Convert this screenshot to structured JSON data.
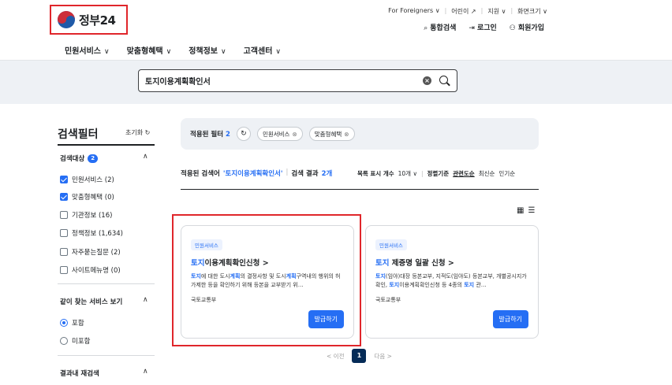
{
  "header": {
    "logo_text": "정부24",
    "util_links": [
      "For Foreigners ∨",
      "어린이 ↗",
      "지원 ∨",
      "화면크기 ∨"
    ],
    "actions": [
      {
        "icon": "search-icon",
        "label": "통합검색"
      },
      {
        "icon": "login-icon",
        "label": "로그인"
      },
      {
        "icon": "user-add-icon",
        "label": "회원가입"
      }
    ],
    "nav": [
      "민원서비스",
      "맞춤형혜택",
      "정책정보",
      "고객센터"
    ]
  },
  "search": {
    "value": "토지이용계획확인서"
  },
  "sidebar": {
    "title": "검색필터",
    "reset_label": "초기화",
    "target": {
      "title": "검색대상",
      "badge": "2",
      "items": [
        {
          "label": "민원서비스 (2)",
          "checked": true
        },
        {
          "label": "맞춤형혜택 (0)",
          "checked": true
        },
        {
          "label": "기관정보 (16)",
          "checked": false
        },
        {
          "label": "정책정보 (1,634)",
          "checked": false
        },
        {
          "label": "자주묻는질문 (2)",
          "checked": false
        },
        {
          "label": "사이트메뉴명 (0)",
          "checked": false
        }
      ]
    },
    "related": {
      "title": "같이 찾는 서비스 보기",
      "options": [
        {
          "label": "포함",
          "selected": true
        },
        {
          "label": "미포함",
          "selected": false
        }
      ]
    },
    "refine": {
      "title": "결과내 재검색"
    }
  },
  "filters": {
    "label": "적용된 필터",
    "count": "2",
    "chips": [
      "민원서비스",
      "맞춤형혜택"
    ]
  },
  "results": {
    "query_label": "적용된 검색어",
    "query": "'토지이용계획확인서'",
    "count_label": "검색 결과",
    "count": "2개",
    "page_size_label": "목록 표시 개수",
    "page_size": "10개",
    "sort_label": "정렬기준",
    "sort_options": [
      "관련도순",
      "최신순",
      "인기순"
    ],
    "sort_active": "관련도순"
  },
  "cards": [
    {
      "tag": "민원서비스",
      "title_key": "토지",
      "title_rest": "이용계획확인신청 >",
      "desc_parts": [
        "토지",
        "에 대한 도시",
        "계획",
        "의 결정사항 및 도시",
        "계획",
        "구역내의 행위의 허가제한 등을 확인하기 위해 등본을 교부받기 위…"
      ],
      "org": "국토교통부",
      "button": "발급하기"
    },
    {
      "tag": "민원서비스",
      "title_key": "토지",
      "title_rest": " 제증명 일괄 신청 >",
      "desc_parts": [
        "토지",
        "(임야)대장 등본교부, 지적도(임야도) 등본교부, 개별공시지가 확인, ",
        "토지",
        "이용계획확인신청 등 4종의 ",
        "토지",
        " 관…"
      ],
      "org": "국토교통부",
      "button": "발급하기"
    }
  ],
  "pager": {
    "prev": "< 이전",
    "current": "1",
    "next": "다음 >"
  },
  "colors": {
    "accent": "#256ef4",
    "highlight_box": "#e0262b",
    "search_band": "#eef1f5"
  }
}
